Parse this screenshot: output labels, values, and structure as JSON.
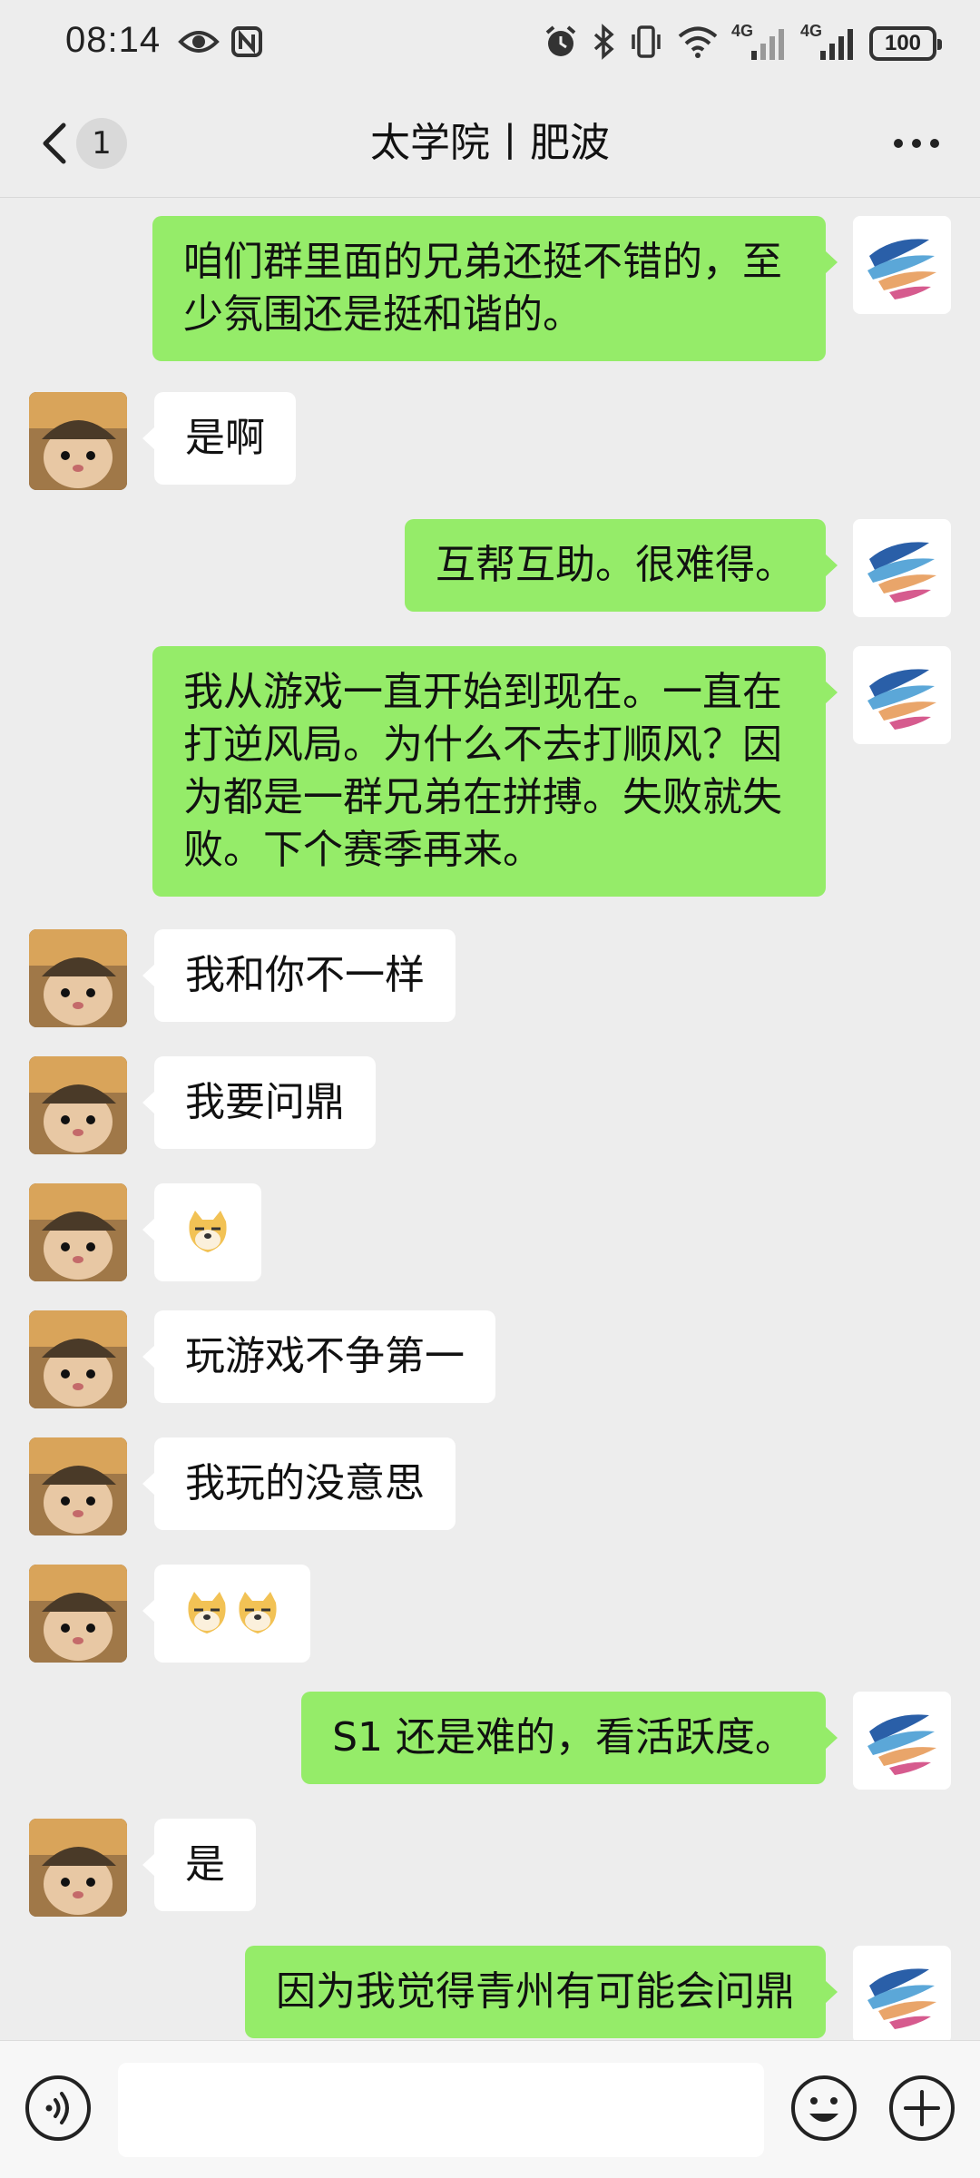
{
  "status_bar": {
    "time": "08:14",
    "left_icons": [
      "eye-icon",
      "nfc-icon"
    ],
    "right_icons": [
      "alarm-icon",
      "bluetooth-icon",
      "vibrate-icon",
      "wifi-icon",
      "signal-4g-icon",
      "signal-4g-icon"
    ],
    "network_label_1": "4G",
    "network_label_2": "4G",
    "battery": "100"
  },
  "header": {
    "back_icon": "chevron-left-icon",
    "unread_count": "1",
    "title": "太学院丨肥波",
    "more_icon": "more-dots-icon"
  },
  "messages": [
    {
      "sender": "self",
      "text": "咱们群里面的兄弟还挺不错的，至\n少氛围还是挺和谐的。"
    },
    {
      "sender": "other",
      "text": "是啊"
    },
    {
      "sender": "self",
      "text": "互帮互助。很难得。"
    },
    {
      "sender": "self",
      "text": "我从游戏一直开始到现在。一直在\n打逆风局。为什么不去打顺风？因\n为都是一群兄弟在拼搏。失败就失\n败。下个赛季再来。"
    },
    {
      "sender": "other",
      "text": "我和你不一样"
    },
    {
      "sender": "other",
      "text": "我要问鼎"
    },
    {
      "sender": "other",
      "text": "",
      "emoji": "doge-emoji"
    },
    {
      "sender": "other",
      "text": "玩游戏不争第一"
    },
    {
      "sender": "other",
      "text": "我玩的没意思"
    },
    {
      "sender": "other",
      "text": "",
      "emoji": "doge-emoji-x2"
    },
    {
      "sender": "self",
      "text": "S1 还是难的，看活跃度。"
    },
    {
      "sender": "other",
      "text": "是"
    },
    {
      "sender": "self",
      "text": "因为我觉得青州有可能会问鼎"
    }
  ],
  "input_bar": {
    "voice_icon": "voice-icon",
    "emoji_icon": "smiley-icon",
    "plus_icon": "plus-circle-icon",
    "placeholder": ""
  },
  "colors": {
    "self_bubble": "#95ec69",
    "other_bubble": "#ffffff",
    "background": "#ededed"
  }
}
